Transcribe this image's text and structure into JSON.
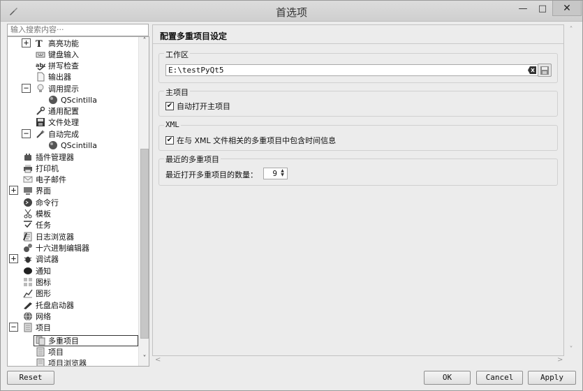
{
  "window": {
    "title": "首选项",
    "minimize": "—",
    "maximize": "□",
    "close": "✕"
  },
  "sidebar": {
    "search_placeholder": "输入搜索内容···",
    "items": [
      {
        "label": "高亮功能",
        "icon": "text-style-icon"
      },
      {
        "label": "键盘输入",
        "icon": "keyboard-icon"
      },
      {
        "label": "拼写检查",
        "icon": "spellcheck-icon"
      },
      {
        "label": "输出器",
        "icon": "document-icon"
      },
      {
        "label": "调用提示",
        "icon": "lightbulb-icon"
      },
      {
        "label": "QScintilla",
        "icon": "sphere-icon"
      },
      {
        "label": "通用配置",
        "icon": "wrench-icon"
      },
      {
        "label": "文件处理",
        "icon": "floppy-icon"
      },
      {
        "label": "自动完成",
        "icon": "wand-icon"
      },
      {
        "label": "QScintilla",
        "icon": "sphere-icon"
      },
      {
        "label": "插件管理器",
        "icon": "plugin-icon"
      },
      {
        "label": "打印机",
        "icon": "printer-icon"
      },
      {
        "label": "电子邮件",
        "icon": "mail-icon"
      },
      {
        "label": "界面",
        "icon": "monitor-icon"
      },
      {
        "label": "命令行",
        "icon": "terminal-icon"
      },
      {
        "label": "模板",
        "icon": "scissors-icon"
      },
      {
        "label": "任务",
        "icon": "tasks-icon"
      },
      {
        "label": "日志浏览器",
        "icon": "log-icon"
      },
      {
        "label": "十六进制编辑器",
        "icon": "hex-icon"
      },
      {
        "label": "调试器",
        "icon": "bug-icon"
      },
      {
        "label": "通知",
        "icon": "bubble-icon"
      },
      {
        "label": "图标",
        "icon": "grid-icon"
      },
      {
        "label": "图形",
        "icon": "graph-icon"
      },
      {
        "label": "托盘启动器",
        "icon": "tray-icon"
      },
      {
        "label": "网络",
        "icon": "globe-icon"
      },
      {
        "label": "项目",
        "icon": "project-icon"
      },
      {
        "label": "多重项目",
        "icon": "multiproject-icon"
      },
      {
        "label": "项目",
        "icon": "project-icon"
      },
      {
        "label": "项目浏览器",
        "icon": "project-browser-icon"
      }
    ]
  },
  "content": {
    "title": "配置多重项目设定",
    "workspace": {
      "group_label": "工作区",
      "path": "E:\\testPyQt5"
    },
    "main_project": {
      "group_label": "主项目",
      "checkbox_label": "自动打开主项目",
      "checked": true
    },
    "xml": {
      "group_label": "XML",
      "checkbox_label": "在与 XML 文件相关的多重项目中包含时间信息",
      "checked": true
    },
    "recent": {
      "group_label": "最近的多重项目",
      "spin_label": "最近打开多重项目的数量：",
      "spin_value": "9"
    }
  },
  "buttons": {
    "reset": "Reset",
    "ok": "OK",
    "cancel": "Cancel",
    "apply": "Apply"
  },
  "colors": {
    "background": "#ececec",
    "selection_border": "#333333"
  }
}
